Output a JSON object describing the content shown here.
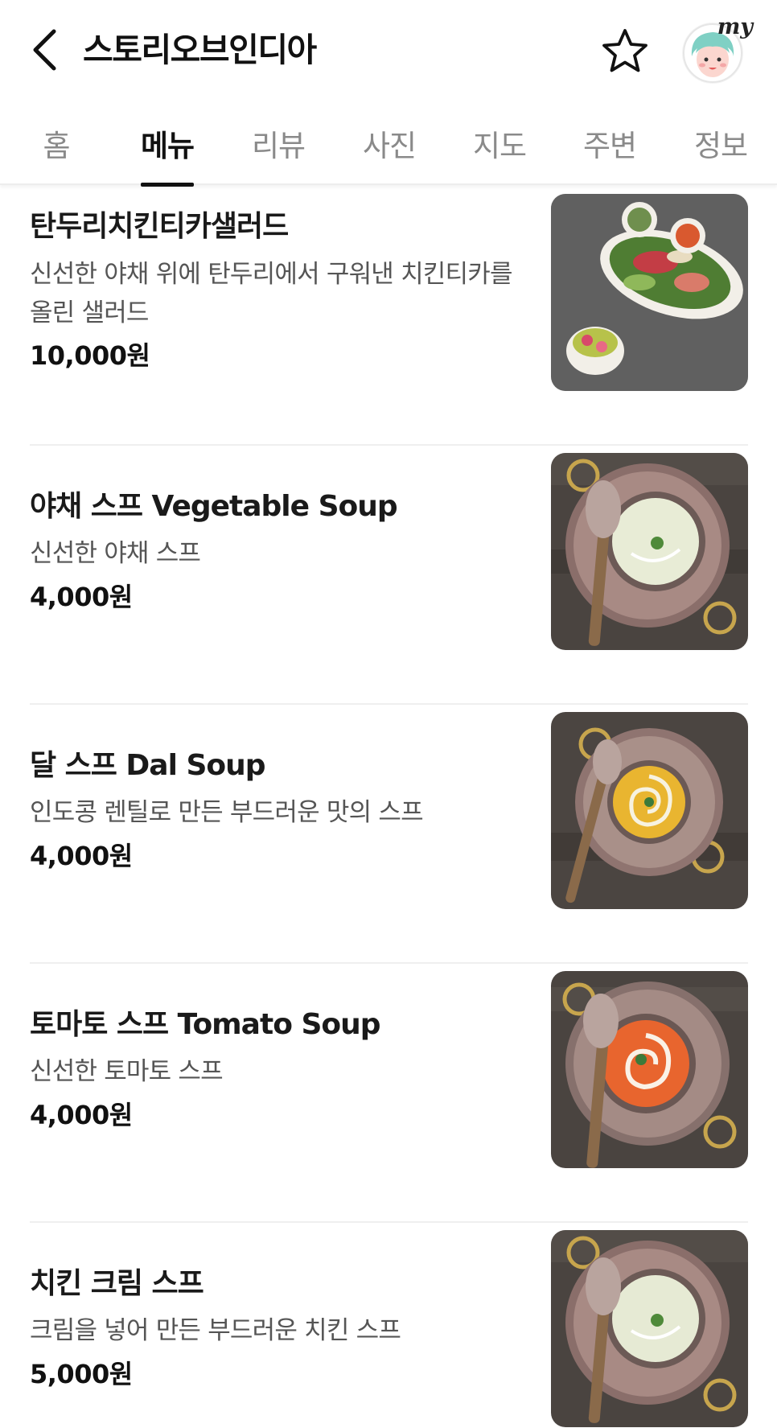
{
  "header": {
    "title": "스토리오브인디아",
    "back_icon": "chevron-left-icon",
    "favorite_icon": "star-outline-icon",
    "avatar_badge": "my"
  },
  "tabs": [
    {
      "label": "홈",
      "active": false
    },
    {
      "label": "메뉴",
      "active": true
    },
    {
      "label": "리뷰",
      "active": false
    },
    {
      "label": "사진",
      "active": false
    },
    {
      "label": "지도",
      "active": false
    },
    {
      "label": "주변",
      "active": false
    },
    {
      "label": "정보",
      "active": false
    }
  ],
  "menu": [
    {
      "name": "탄두리치킨티카샐러드",
      "description": "신선한 야채 위에 탄두리에서 구워낸 치킨티카를 올린 샐러드",
      "price": "10,000원"
    },
    {
      "name": "야채 스프 Vegetable Soup",
      "description": "신선한 야채 스프",
      "price": "4,000원"
    },
    {
      "name": "달 스프 Dal Soup",
      "description": "인도콩 렌틸로 만든 부드러운 맛의 스프",
      "price": "4,000원"
    },
    {
      "name": "토마토 스프 Tomato Soup",
      "description": "신선한 토마토 스프",
      "price": "4,000원"
    },
    {
      "name": "치킨 크림 스프",
      "description": "크림을 넣어 만든 부드러운 치킨 스프",
      "price": "5,000원"
    }
  ],
  "colors": {
    "soup_vegetable": "#e8ecd6",
    "soup_dal": "#e9b530",
    "soup_tomato": "#e8652e",
    "soup_cream": "#e6ead4"
  }
}
